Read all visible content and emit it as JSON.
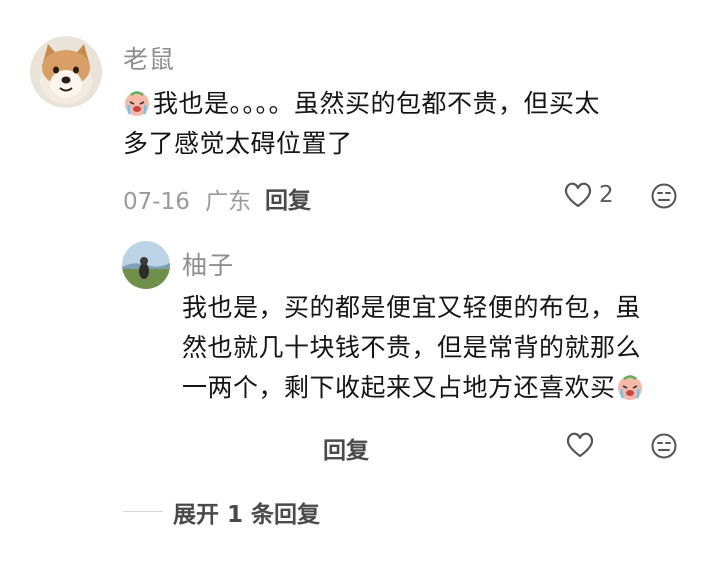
{
  "comment": {
    "username": "老鼠",
    "avatar_icon": "shiba-dog-avatar",
    "emoji_icon": "crying-face-emoji",
    "text_line1": "我也是。。。。虽然买的包都不贵，但买太",
    "text_line2": "多了感觉太碍位置了",
    "date": "07-16",
    "location": "广东",
    "reply_label": "回复",
    "like_count": "2"
  },
  "reply": {
    "username": "柚子",
    "avatar_icon": "landscape-avatar",
    "text_line1": "我也是，买的都是便宜又轻便的布包，虽",
    "text_line2": "然也就几十块钱不贵，但是常背的就那么",
    "text_line3": "一两个，剩下收起来又占地方还喜欢买",
    "emoji_icon": "crying-face-emoji",
    "reply_label": "回复"
  },
  "expand": {
    "label": "展开 1 条回复"
  },
  "colors": {
    "text_primary": "#151515",
    "text_secondary": "#8e8e8e",
    "icon": "#555555"
  }
}
